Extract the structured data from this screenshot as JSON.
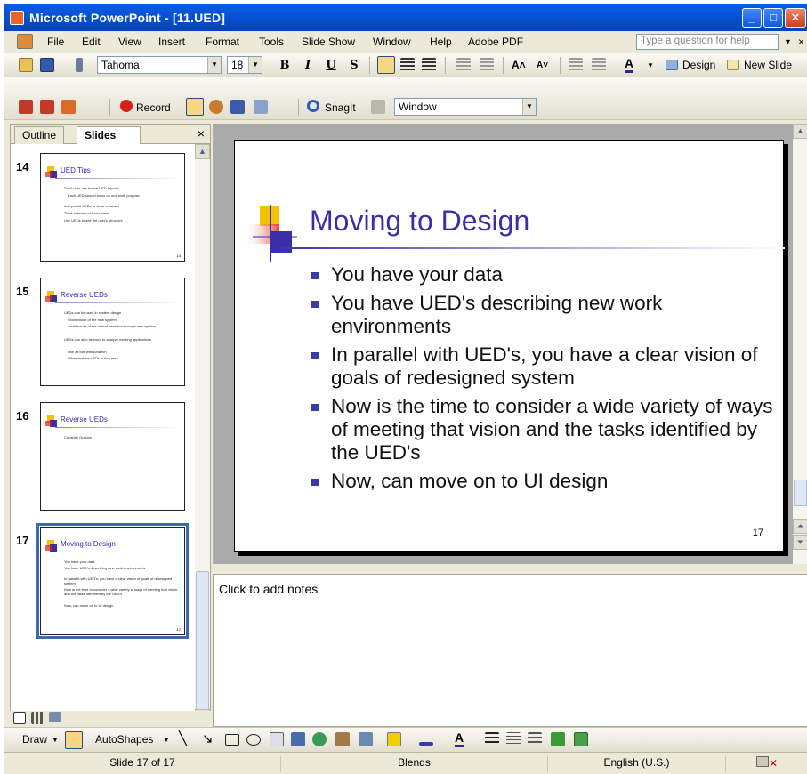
{
  "window": {
    "title": "Microsoft PowerPoint - [11.UED]"
  },
  "menu": {
    "items": [
      "File",
      "Edit",
      "View",
      "Insert",
      "Format",
      "Tools",
      "Slide Show",
      "Window",
      "Help",
      "Adobe PDF"
    ],
    "ask_placeholder": "Type a question for help"
  },
  "formatting": {
    "font": "Tahoma",
    "size": "18",
    "bold": "B",
    "italic": "I",
    "underline": "U",
    "shadow": "S",
    "design_label": "Design",
    "new_slide_label": "New Slide"
  },
  "toolbar3": {
    "record_label": "Record",
    "snagit_label": "SnagIt",
    "window_combo": "Window"
  },
  "pane": {
    "tab_outline": "Outline",
    "tab_slides": "Slides",
    "close": "×",
    "thumbnails": [
      {
        "num": "14",
        "title": "UED Tips",
        "lines": [
          "Don't over-use formal UED layouts",
          "Each UED should focus on one work purpose",
          "Use partial UEDs to show a subset",
          "Think in terms of focus areas",
          "Use UEDs to see the user's structure"
        ]
      },
      {
        "num": "15",
        "title": "Reverse UEDs",
        "lines": [
          "UEDs can be used in system design",
          "Show vision of the new system",
          "Architecture of the overall workflow through new system",
          "UEDs can also be used to analyze existing applications",
          "Use as this with Amazon",
          "Other reverse UEDs in this area"
        ]
      },
      {
        "num": "16",
        "title": "Reverse UEDs",
        "lines": [
          "Consider Outlook"
        ]
      },
      {
        "num": "17",
        "title": "Moving to Design",
        "lines": [
          "You have your data",
          "You have UED's describing new work environments",
          "In parallel with UED's, you have a clear vision of goals of redesigned system",
          "Now is the time to consider a wide variety of ways of meeting that vision and the tasks identified by the UED's",
          "Now, can move on to UI design"
        ]
      }
    ]
  },
  "slide": {
    "title": "Moving to Design",
    "bullets": [
      "You have your data",
      "You have UED's describing new work environments",
      "In parallel with UED's, you have a clear vision of goals of redesigned system",
      "Now is the time to consider a wide variety of ways of meeting that vision and the tasks identified by the UED's",
      "Now, can move on to UI design"
    ],
    "number": "17"
  },
  "notes": {
    "placeholder": "Click to add notes"
  },
  "drawing": {
    "draw_label": "Draw",
    "autoshapes_label": "AutoShapes"
  },
  "status": {
    "slide_pos": "Slide 17 of 17",
    "design": "Blends",
    "language": "English (U.S.)"
  },
  "colors": {
    "title_blue": "#3b2fa7",
    "xp_blue": "#0653d4",
    "selection": "#3a6ab4"
  }
}
